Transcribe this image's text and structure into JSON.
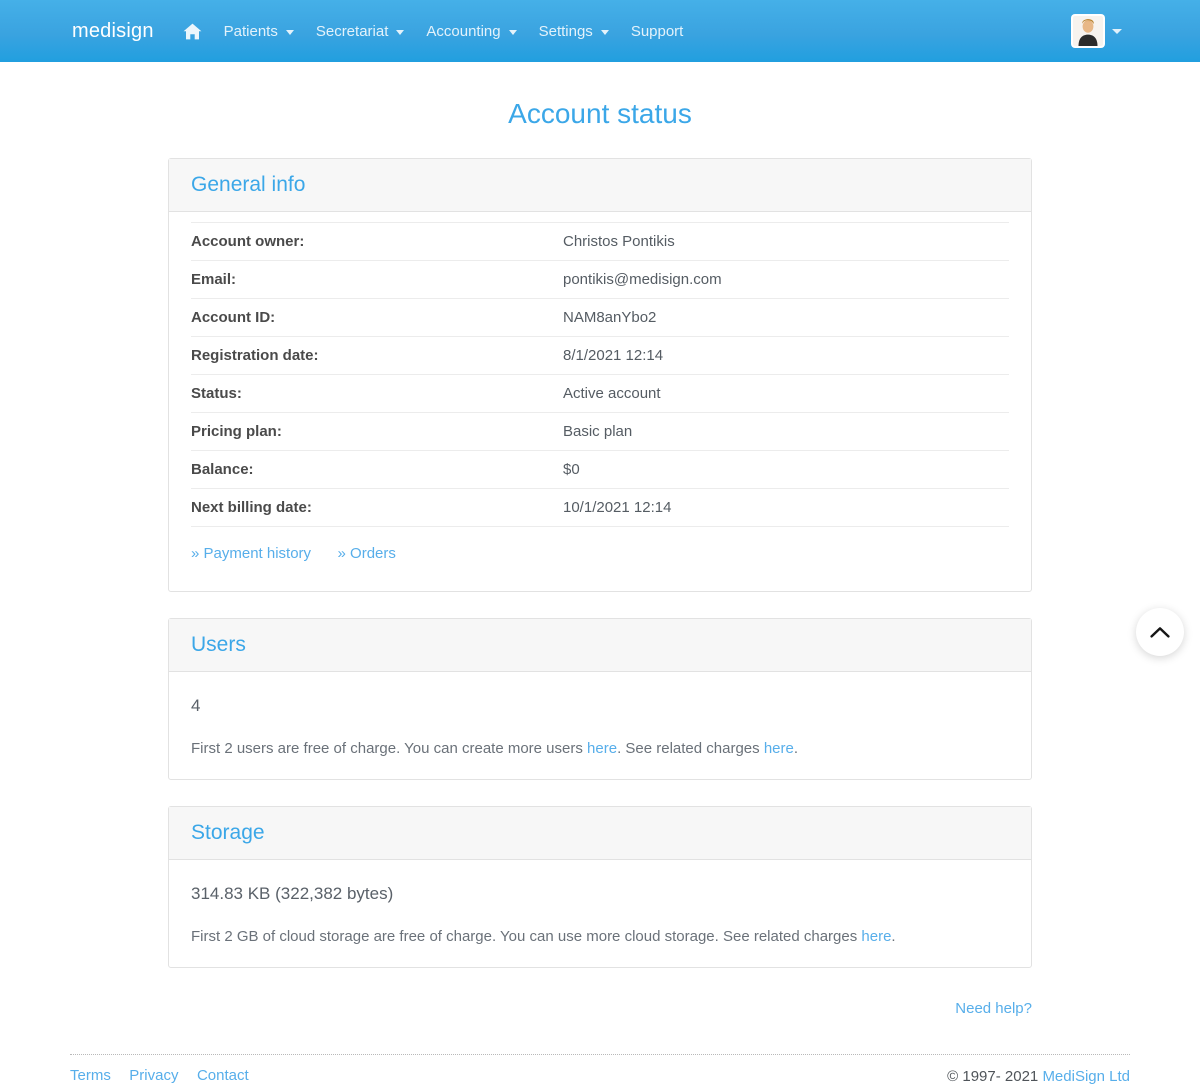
{
  "navbar": {
    "brand": "medisign",
    "home_icon": "home-icon",
    "items": [
      {
        "label": "Patients",
        "has_caret": true
      },
      {
        "label": "Secretariat",
        "has_caret": true
      },
      {
        "label": "Accounting",
        "has_caret": true
      },
      {
        "label": "Settings",
        "has_caret": true
      },
      {
        "label": "Support",
        "has_caret": false
      }
    ],
    "avatar_icon": "user-avatar",
    "avatar_caret": "chevron-down-icon"
  },
  "page": {
    "title": "Account status"
  },
  "general_info": {
    "heading": "General info",
    "rows": [
      {
        "label": "Account owner:",
        "value": "Christos Pontikis"
      },
      {
        "label": "Email:",
        "value": "pontikis@medisign.com"
      },
      {
        "label": "Account ID:",
        "value": "NAM8anYbo2"
      },
      {
        "label": "Registration date:",
        "value": "8/1/2021 12:14"
      },
      {
        "label": "Status:",
        "value": "Active account"
      },
      {
        "label": "Pricing plan:",
        "value": "Basic plan"
      },
      {
        "label": "Balance:",
        "value": "$0"
      },
      {
        "label": "Next billing date:",
        "value": "10/1/2021 12:14"
      }
    ],
    "balance_color": "#8cc63f",
    "links": [
      {
        "label": "» Payment history"
      },
      {
        "label": "» Orders"
      }
    ]
  },
  "users": {
    "heading": "Users",
    "count": "4",
    "note_part1": "First 2 users are free of charge. You can create more users ",
    "note_link1": "here",
    "note_part2": ". See related charges ",
    "note_link2": "here",
    "note_part3": "."
  },
  "storage": {
    "heading": "Storage",
    "used": "314.83 KB (322,382 bytes)",
    "note_part1": "First 2 GB of cloud storage are free of charge. You can use more cloud storage. See related charges ",
    "note_link1": "here",
    "note_part2": "."
  },
  "help": {
    "label": "Need help?"
  },
  "footer": {
    "links": [
      {
        "label": "Terms"
      },
      {
        "label": "Privacy"
      },
      {
        "label": "Contact"
      }
    ],
    "copyright_text": "© 1997- 2021 ",
    "copyright_link": "MediSign Ltd"
  },
  "scroll_top": {
    "icon": "chevron-up-icon"
  },
  "colors": {
    "brand_blue": "#3ba7e8",
    "navbar_top": "#45b0e8",
    "navbar_bottom": "#219fdf",
    "link_blue": "#57aeea",
    "green": "#8cc63f"
  }
}
